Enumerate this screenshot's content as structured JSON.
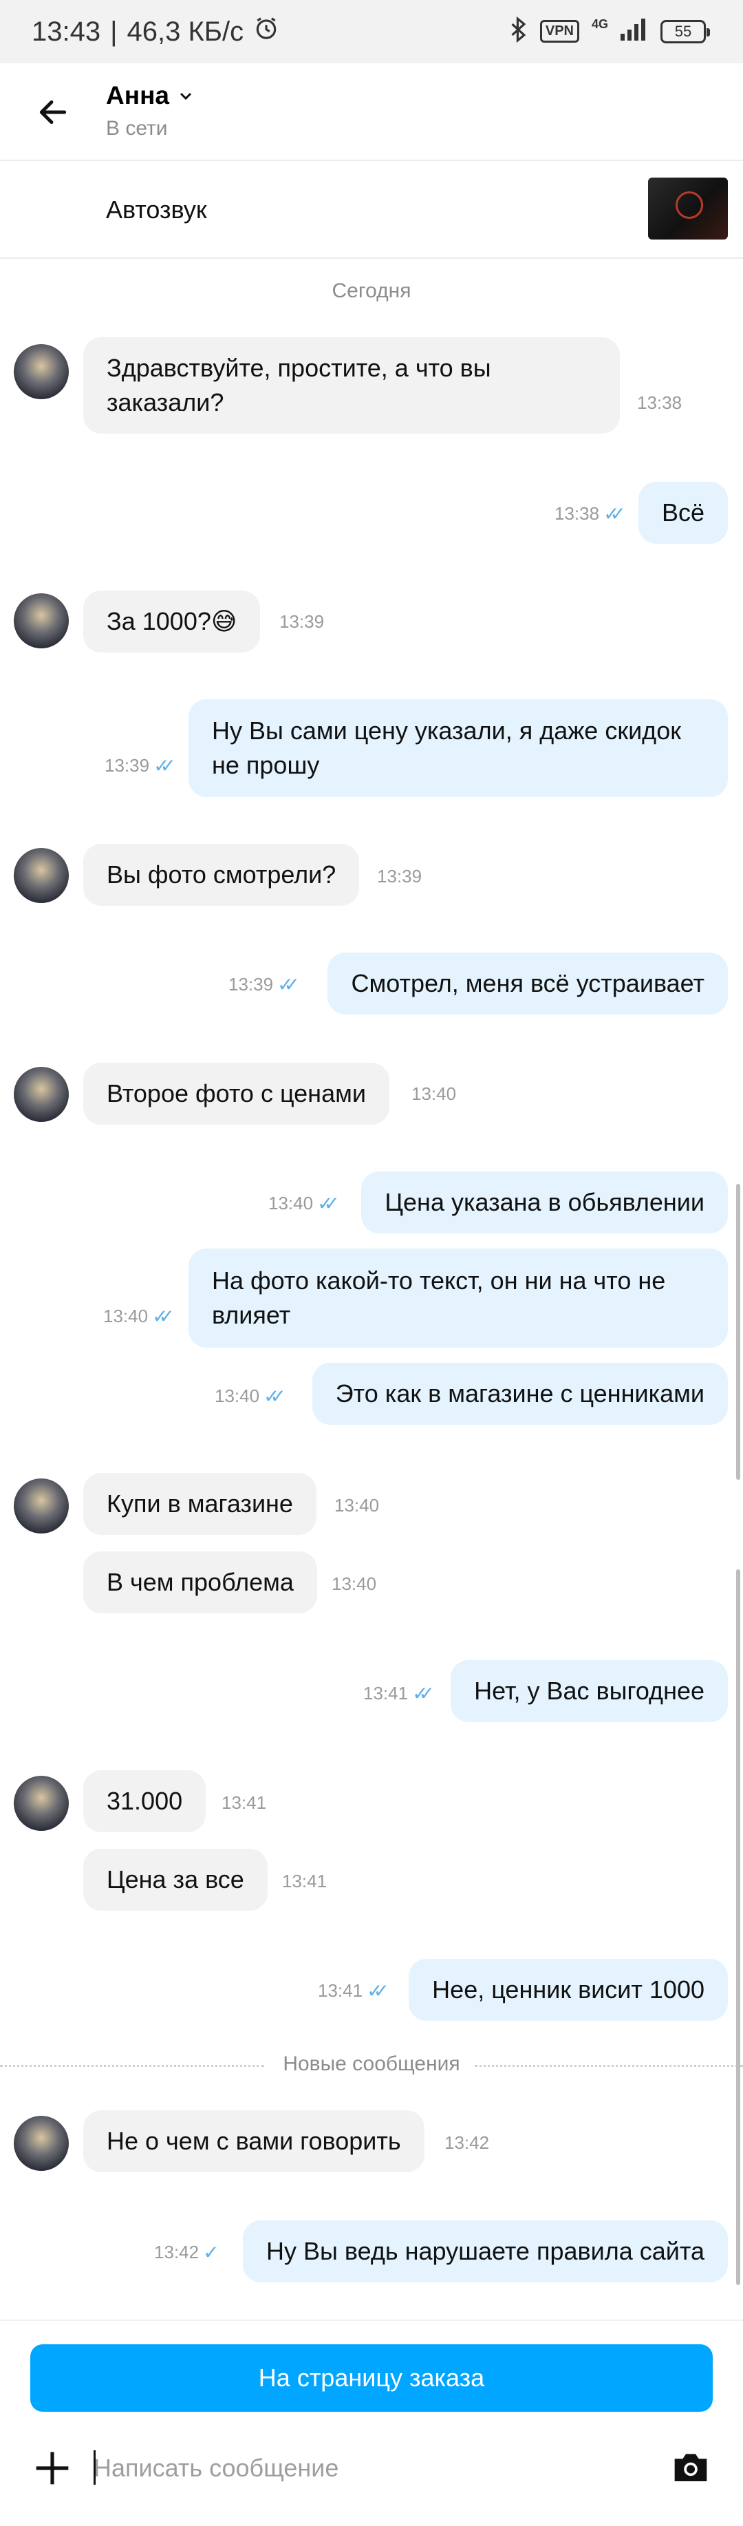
{
  "status_bar": {
    "time": "13:43",
    "separator": "|",
    "speed": "46,3 КБ/с",
    "vpn": "VPN",
    "network": "4G",
    "battery": "55"
  },
  "header": {
    "name": "Анна",
    "status": "В сети"
  },
  "product": {
    "title": "Автозвук"
  },
  "date_separator": "Сегодня",
  "messages": [
    {
      "dir": "in",
      "text": "Здравствуйте, простите, а что вы заказали?",
      "time": "13:38"
    },
    {
      "dir": "out",
      "text": "Всё",
      "time": "13:38"
    },
    {
      "dir": "in",
      "text": "За 1000?😅",
      "time": "13:39"
    },
    {
      "dir": "out",
      "text": "Ну Вы сами цену указали, я даже скидок не прошу",
      "time": "13:39"
    },
    {
      "dir": "in",
      "text": "Вы фото смотрели?",
      "time": "13:39"
    },
    {
      "dir": "out",
      "text": "Смотрел, меня всё устраивает",
      "time": "13:39"
    },
    {
      "dir": "in",
      "text": "Второе фото с ценами",
      "time": "13:40"
    },
    {
      "dir": "out",
      "text": "Цена указана в обьявлении",
      "time": "13:40"
    },
    {
      "dir": "out",
      "text": "На фото какой-то текст, он ни на что не влияет",
      "time": "13:40"
    },
    {
      "dir": "out",
      "text": "Это как в магазине с ценниками",
      "time": "13:40"
    },
    {
      "dir": "in",
      "text": "Купи в магазине",
      "time": "13:40"
    },
    {
      "dir": "in",
      "text": "В чем проблема",
      "time": "13:40"
    },
    {
      "dir": "out",
      "text": "Нет, у Вас выгоднее",
      "time": "13:41"
    },
    {
      "dir": "in",
      "text": "31.000",
      "time": "13:41"
    },
    {
      "dir": "in",
      "text": "Цена за все",
      "time": "13:41"
    },
    {
      "dir": "out",
      "text": "Нее, ценник висит 1000",
      "time": "13:41"
    },
    {
      "dir": "in",
      "text": "Не о чем с вами говорить",
      "time": "13:42"
    },
    {
      "dir": "out",
      "text": "Ну Вы ведь нарушаете правила сайта",
      "time": "13:42"
    }
  ],
  "new_messages_label": "Новые сообщения",
  "bottom": {
    "order_button": "На страницу заказа",
    "input_placeholder": "Написать сообщение"
  },
  "colors": {
    "accent": "#00a6ff",
    "outgoing_bubble": "#e4f3fd",
    "incoming_bubble": "#f2f2f2",
    "read_check": "#5fb0e8"
  }
}
